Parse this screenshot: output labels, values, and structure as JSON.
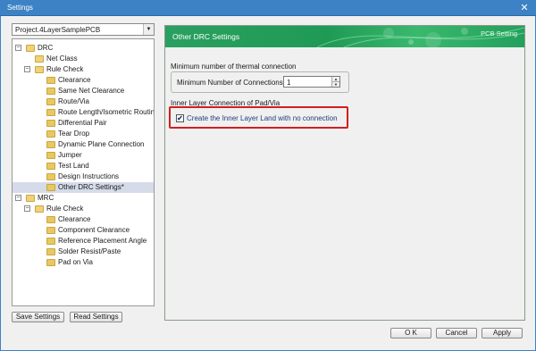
{
  "window": {
    "title": "Settings",
    "close_glyph": "✕"
  },
  "project": {
    "value": "Project.4LayerSamplePCB"
  },
  "tree": {
    "expander_expanded": "−",
    "items": [
      {
        "label": "DRC",
        "level": 0,
        "expander": true
      },
      {
        "label": "Net Class",
        "level": 1,
        "expander": false
      },
      {
        "label": "Rule Check",
        "level": 1,
        "expander": true
      },
      {
        "label": "Clearance",
        "level": 2,
        "expander": false
      },
      {
        "label": "Same Net Clearance",
        "level": 2,
        "expander": false
      },
      {
        "label": "Route/Via",
        "level": 2,
        "expander": false
      },
      {
        "label": "Route Length/Isometric Routing",
        "level": 2,
        "expander": false
      },
      {
        "label": "Differential Pair",
        "level": 2,
        "expander": false
      },
      {
        "label": "Tear Drop",
        "level": 2,
        "expander": false
      },
      {
        "label": "Dynamic Plane Connection",
        "level": 2,
        "expander": false
      },
      {
        "label": "Jumper",
        "level": 2,
        "expander": false
      },
      {
        "label": "Test Land",
        "level": 2,
        "expander": false
      },
      {
        "label": "Design Instructions",
        "level": 2,
        "expander": false
      },
      {
        "label": "Other DRC Settings*",
        "level": 2,
        "expander": false,
        "selected": true
      },
      {
        "label": "MRC",
        "level": 0,
        "expander": true
      },
      {
        "label": "Rule Check",
        "level": 1,
        "expander": true
      },
      {
        "label": "Clearance",
        "level": 2,
        "expander": false
      },
      {
        "label": "Component Clearance",
        "level": 2,
        "expander": false
      },
      {
        "label": "Reference Placement Angle",
        "level": 2,
        "expander": false
      },
      {
        "label": "Solder Resist/Paste",
        "level": 2,
        "expander": false
      },
      {
        "label": "Pad on Via",
        "level": 2,
        "expander": false
      }
    ]
  },
  "left_buttons": {
    "save": "Save Settings",
    "read": "Read Settings"
  },
  "panel": {
    "title": "Other DRC Settings",
    "badge": "PCB Setting",
    "thermal": {
      "section_label": "Minimum number of thermal connection",
      "field_label": "Minimum Number of Connections",
      "value": "1"
    },
    "inner_layer": {
      "section_label": "Inner Layer Connection of Pad/Via",
      "checkbox_label": "Create the Inner Layer Land with no connection",
      "checked": true,
      "check_glyph": "✔"
    }
  },
  "dialog_buttons": {
    "ok": "O K",
    "cancel": "Cancel",
    "apply": "Apply"
  },
  "colors": {
    "titlebar": "#3c82c4",
    "banner": "#1f9a55",
    "highlight": "#d02020",
    "selected_row": "#d6dbe9"
  }
}
